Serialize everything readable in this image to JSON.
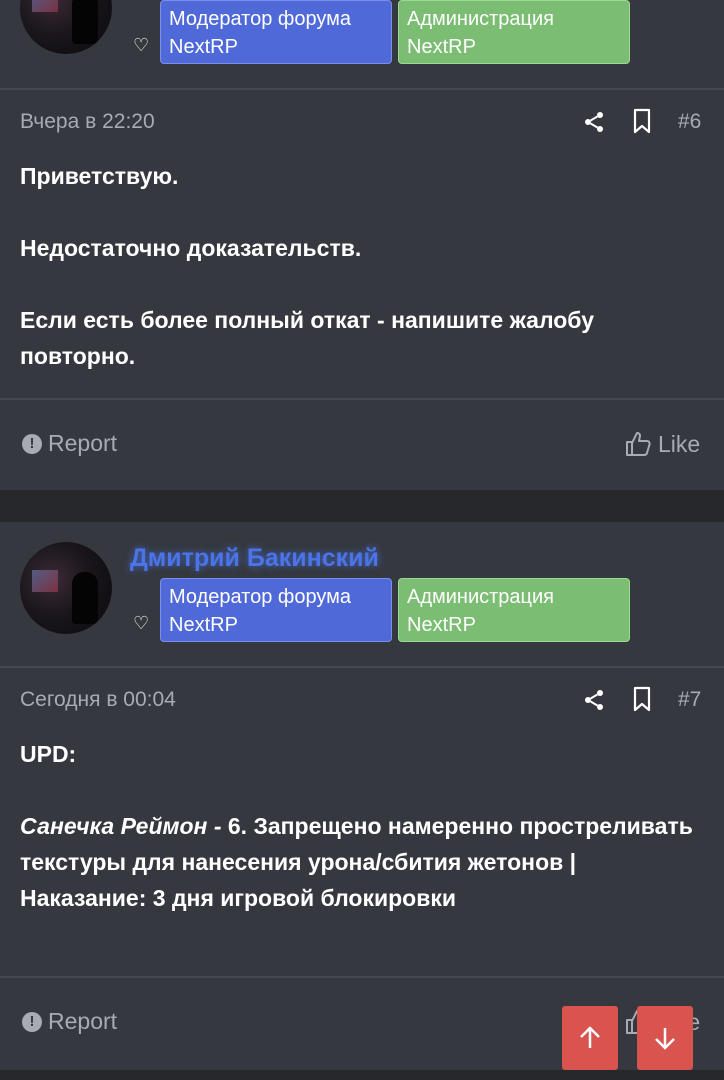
{
  "posts": [
    {
      "username": "",
      "badges": {
        "moderator": "Модератор форума NextRP",
        "admin": "Администрация NextRP"
      },
      "date": "Вчера в 22:20",
      "number": "#6",
      "paragraphs": [
        "Приветствую.",
        "Недостаточно доказательств.",
        "Если есть более полный откат - напишите жалобу повторно."
      ],
      "report_label": "Report",
      "like_label": "Like"
    },
    {
      "username": "Дмитрий Бакинский",
      "badges": {
        "moderator": "Модератор форума NextRP",
        "admin": "Администрация NextRP"
      },
      "date": "Сегодня в 00:04",
      "number": "#7",
      "paragraphs": [
        "UPD:"
      ],
      "quote_name": "Санечка Реймон -",
      "quote_text": " 6. Запрещено намеренно простреливать текстуры для нанесения урона/сбития жетонов | Наказание: 3 дня игровой блокировки",
      "report_label": "Report",
      "like_label": "Like"
    }
  ],
  "icons": {
    "heart": "heart-icon",
    "share": "share-icon",
    "bookmark": "bookmark-icon",
    "report": "exclamation-circle-icon",
    "like": "thumbs-up-icon",
    "scroll_up": "arrow-up-icon",
    "scroll_down": "arrow-down-icon"
  },
  "colors": {
    "username": "#4a74e8",
    "moderator_badge": "#4f69d9",
    "admin_badge": "#7bbd72",
    "scroll_button": "#d9534f",
    "post_bg": "#35383e",
    "page_bg": "#26282c"
  }
}
